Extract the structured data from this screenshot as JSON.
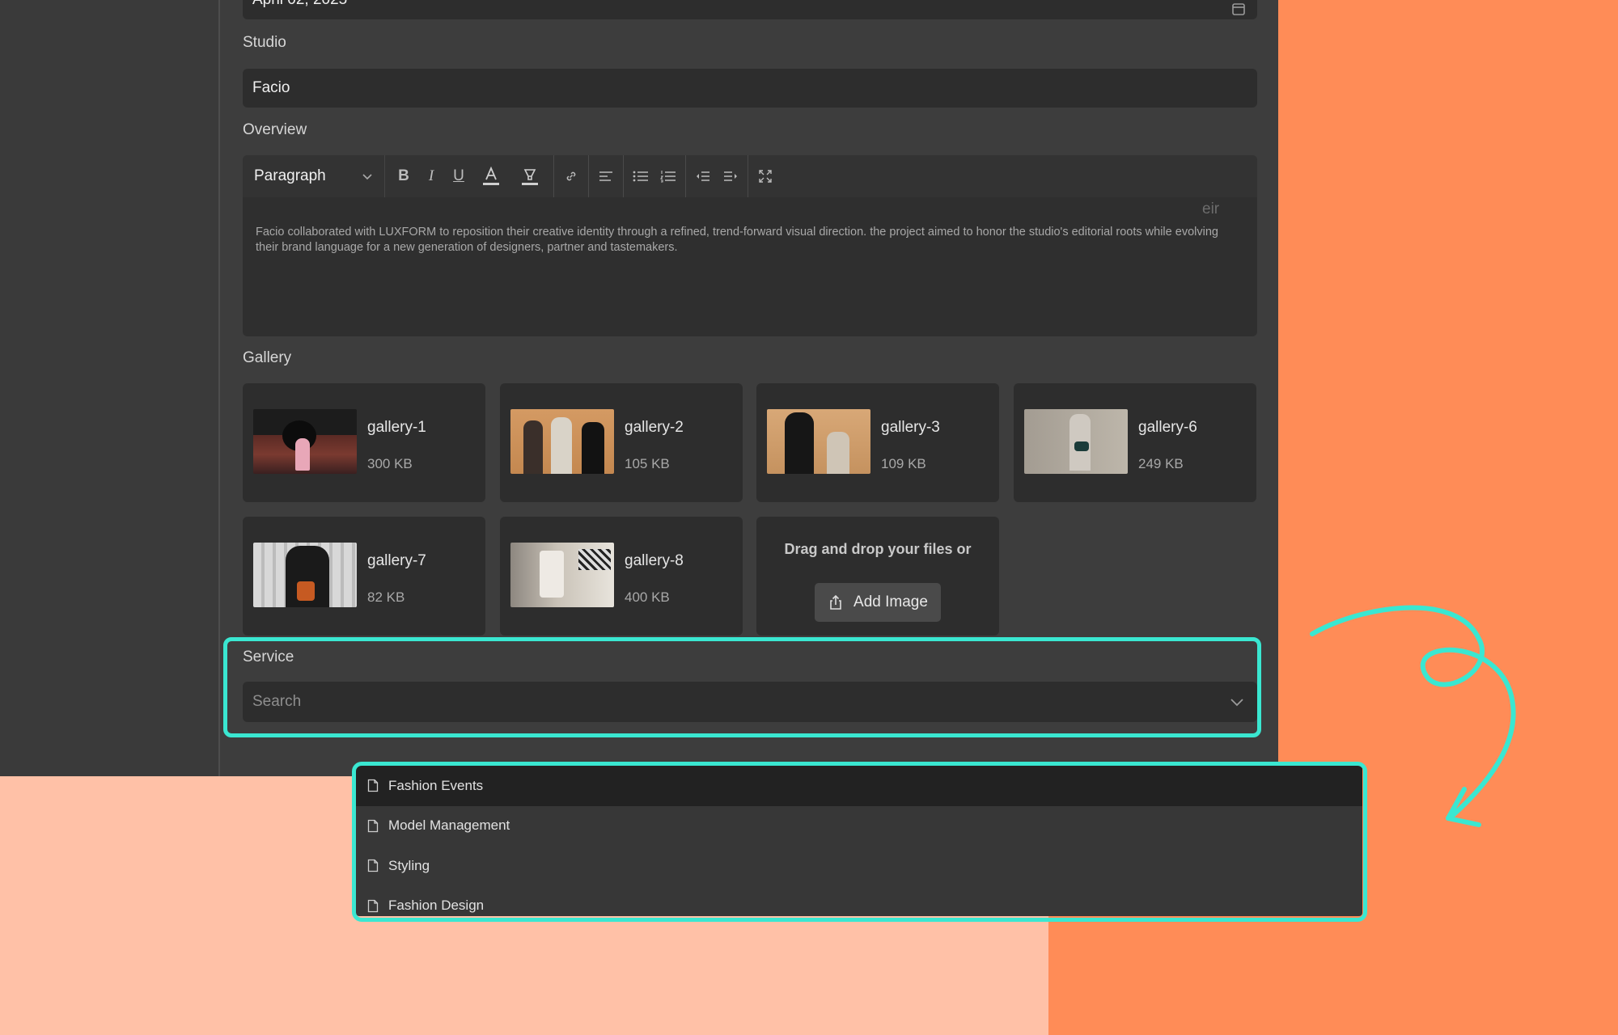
{
  "date_field": {
    "value": "April 02, 2025"
  },
  "studio": {
    "label": "Studio",
    "value": "Facio"
  },
  "overview": {
    "label": "Overview",
    "toolbar": {
      "block_type": "Paragraph"
    },
    "ghost_text": "eir",
    "text": "Facio collaborated with LUXFORM to reposition their creative identity through a refined, trend-forward visual direction. the project aimed to honor the studio's editorial roots while evolving their brand language for a new generation of designers, partner and tastemakers."
  },
  "gallery": {
    "label": "Gallery",
    "items": [
      {
        "name": "gallery-1",
        "size": "300 KB"
      },
      {
        "name": "gallery-2",
        "size": "105 KB"
      },
      {
        "name": "gallery-3",
        "size": "109 KB"
      },
      {
        "name": "gallery-6",
        "size": "249 KB"
      },
      {
        "name": "gallery-7",
        "size": "82 KB"
      },
      {
        "name": "gallery-8",
        "size": "400 KB"
      }
    ],
    "upload": {
      "text": "Drag and drop your files or",
      "button": "Add Image"
    }
  },
  "service": {
    "label": "Service",
    "placeholder": "Search",
    "options": [
      {
        "label": "Fashion Events",
        "highlighted": true
      },
      {
        "label": "Model Management",
        "highlighted": false
      },
      {
        "label": "Styling",
        "highlighted": false
      },
      {
        "label": "Fashion Design",
        "highlighted": false
      }
    ]
  },
  "colors": {
    "accent_highlight": "#3ae7d1",
    "orange_bg": "#ff8c57",
    "peach_bg": "#ffc1a7",
    "panel_bg": "#3d3d3d",
    "field_bg": "#2d2d2d"
  }
}
